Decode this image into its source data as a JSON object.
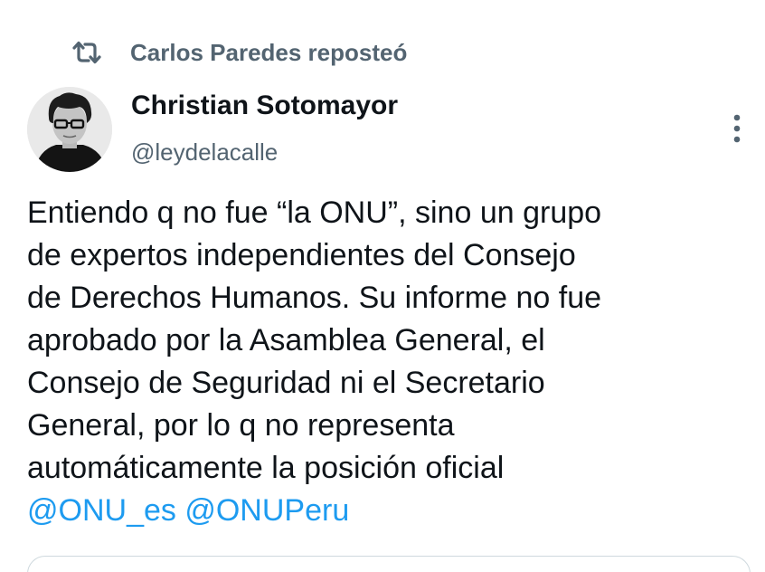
{
  "repost": {
    "icon": "repost-icon",
    "text": "Carlos Paredes reposteó"
  },
  "author": {
    "name": "Christian Sotomayor",
    "handle": "@leydelacalle"
  },
  "menu": {
    "icon": "more-vertical-icon"
  },
  "tweet": {
    "lines": [
      "Entiendo q no fue “la ONU”, sino un grupo",
      "de expertos independientes del Consejo",
      "de Derechos Humanos. Su informe no fue",
      "aprobado por la Asamblea General, el",
      "Consejo de Seguridad ni el Secretario",
      "General, por lo q no representa",
      "automáticamente la posición oficial"
    ],
    "mentions": [
      "@ONU_es",
      "@ONUPeru"
    ]
  },
  "colors": {
    "text": "#0f1419",
    "secondary": "#536471",
    "link": "#1d9bf0",
    "border": "#cfd9de"
  }
}
